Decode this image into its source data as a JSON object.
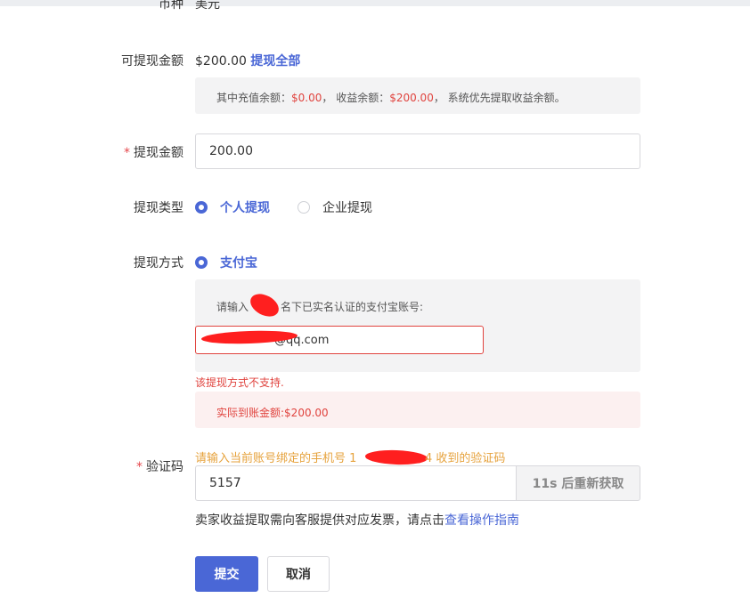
{
  "form": {
    "currency": {
      "label": "币种",
      "value": "美元"
    },
    "available": {
      "label": "可提现金额",
      "amount": "$200.00",
      "withdraw_all": "提现全部",
      "note_prefix": "其中充值余额：",
      "recharge_balance": "$0.00",
      "note_sep1": "，  收益余额：",
      "income_balance": "$200.00",
      "note_suffix": "，  系统优先提取收益余额。"
    },
    "amount": {
      "required_mark": "*",
      "label": "提现金额",
      "value": "200.00"
    },
    "type": {
      "label": "提现类型",
      "options": [
        {
          "label": "个人提现",
          "selected": true
        },
        {
          "label": "企业提现",
          "selected": false
        }
      ]
    },
    "method": {
      "label": "提现方式",
      "option": "支付宝",
      "prompt_start": "请输入",
      "prompt_end": "名下已实名认证的支付宝账号:",
      "account_value": "@qq.com",
      "error": "该提现方式不支持.",
      "actual_label": "实际到账金额:",
      "actual_amount": "$200.00"
    },
    "code": {
      "required_mark": "*",
      "label": "验证码",
      "hint_start": "请输入当前账号绑定的手机号 1",
      "hint_end": "4 收到的验证码",
      "value": "5157",
      "resend": "11s 后重新获取"
    },
    "invoice": {
      "text": "卖家收益提取需向客服提供对应发票，请点击",
      "link": "查看操作指南"
    }
  },
  "buttons": {
    "submit": "提交",
    "cancel": "取消"
  },
  "colors": {
    "accent": "#4a67d6",
    "error": "#e0433e",
    "warning": "#e6a23c"
  }
}
